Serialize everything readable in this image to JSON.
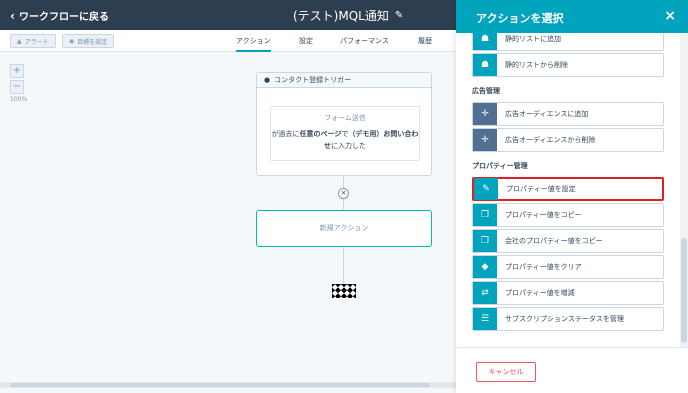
{
  "topbar": {
    "back_label": "ワークフローに戻る",
    "title": "(テスト)MQL通知"
  },
  "subbar": {
    "alert_label": "アラート",
    "goal_label": "目標を設定",
    "tabs": [
      {
        "label": "アクション"
      },
      {
        "label": "設定"
      },
      {
        "label": "パフォーマンス"
      },
      {
        "label": "履歴"
      }
    ]
  },
  "canvas": {
    "zoom_in": "+",
    "zoom_out": "−",
    "zoom_level": "100%",
    "trigger_title": "コンタクト登録トリガー",
    "form_label": "フォーム送信",
    "form_desc_pre": "が過去に",
    "form_desc_bold1": "任意のページ",
    "form_desc_mid": "で",
    "form_desc_bold2": "（デモ用）お問い合わせ",
    "form_desc_post": "に入力した",
    "close_mark": "×",
    "new_action": "新規アクション"
  },
  "panel": {
    "title": "アクションを選択",
    "close": "×",
    "sections": {
      "ads": "広告管理",
      "props": "プロパティー管理"
    },
    "items": [
      {
        "label": "静的リストに追加"
      },
      {
        "label": "静的リストから削除"
      },
      {
        "label": "広告オーディエンスに追加"
      },
      {
        "label": "広告オーディエンスから削除"
      },
      {
        "label": "プロパティー値を設定"
      },
      {
        "label": "プロパティー値をコピー"
      },
      {
        "label": "会社のプロパティー値をコピー"
      },
      {
        "label": "プロパティー値をクリア"
      },
      {
        "label": "プロパティー値を増減"
      },
      {
        "label": "サブスクリプションステータスを管理"
      }
    ],
    "cancel": "キャンセル"
  },
  "colors": {
    "topbar": "#2d3e50",
    "accent": "#00a4bd",
    "icon": "#516f90",
    "highlight": "#e02020",
    "cancel": "#f2545b"
  }
}
